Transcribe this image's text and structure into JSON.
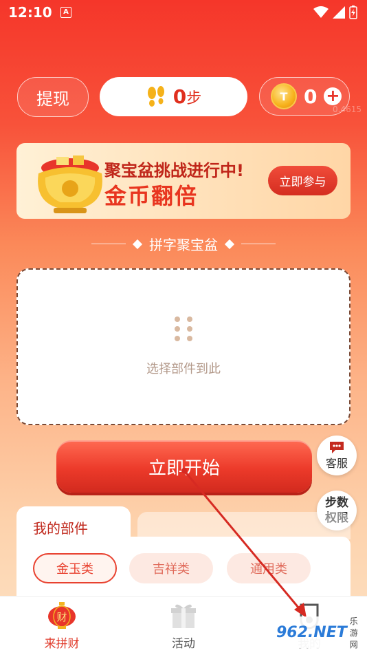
{
  "status_bar": {
    "time": "12:10",
    "notification": "A"
  },
  "top": {
    "withdraw_label": "提现",
    "steps_value": "0",
    "steps_unit": "步",
    "coins_value": "0",
    "plus_label": "+",
    "faded_text": "0.4615"
  },
  "banner": {
    "title": "聚宝盆挑战进行中!",
    "subtitle": "金币翻倍",
    "button": "立即参与"
  },
  "section": {
    "title": "拼字聚宝盆"
  },
  "dropbox": {
    "placeholder": "选择部件到此"
  },
  "start_button": "立即开始",
  "side": {
    "service_label": "客服",
    "steps_perm_line1": "步数",
    "steps_perm_line2": "权限"
  },
  "parts": {
    "title": "我的部件",
    "categories": [
      "金玉类",
      "吉祥类",
      "通用类"
    ]
  },
  "nav": {
    "items": [
      {
        "label": "来拼财",
        "icon": "fortune-lantern-icon"
      },
      {
        "label": "活动",
        "icon": "gift-icon"
      },
      {
        "label": "我的",
        "icon": "user-icon"
      }
    ]
  },
  "watermark": {
    "big": "962.NET",
    "small": "乐游网"
  },
  "colors": {
    "brand_red": "#e8352a",
    "accent_gold": "#f7b21c"
  }
}
